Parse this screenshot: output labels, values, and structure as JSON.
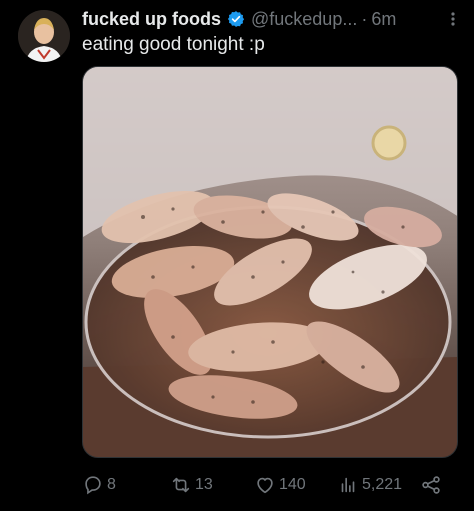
{
  "tweet": {
    "author": {
      "display_name": "fucked up foods",
      "handle": "@fuckedup...",
      "avatar_icon": "profile-avatar-chef"
    },
    "separator": "·",
    "timestamp": "6m",
    "more_icon": "more-options-icon",
    "text": "eating good tonight :p",
    "media": {
      "description_icon": "photo-media-image"
    }
  },
  "actions": {
    "reply_count": "8",
    "retweet_count": "13",
    "like_count": "140",
    "views_count": "5,221"
  },
  "colors": {
    "background": "#000000",
    "primary_text": "#e7e9ea",
    "secondary_text": "#71767b",
    "verified": "#1d9bf0"
  }
}
